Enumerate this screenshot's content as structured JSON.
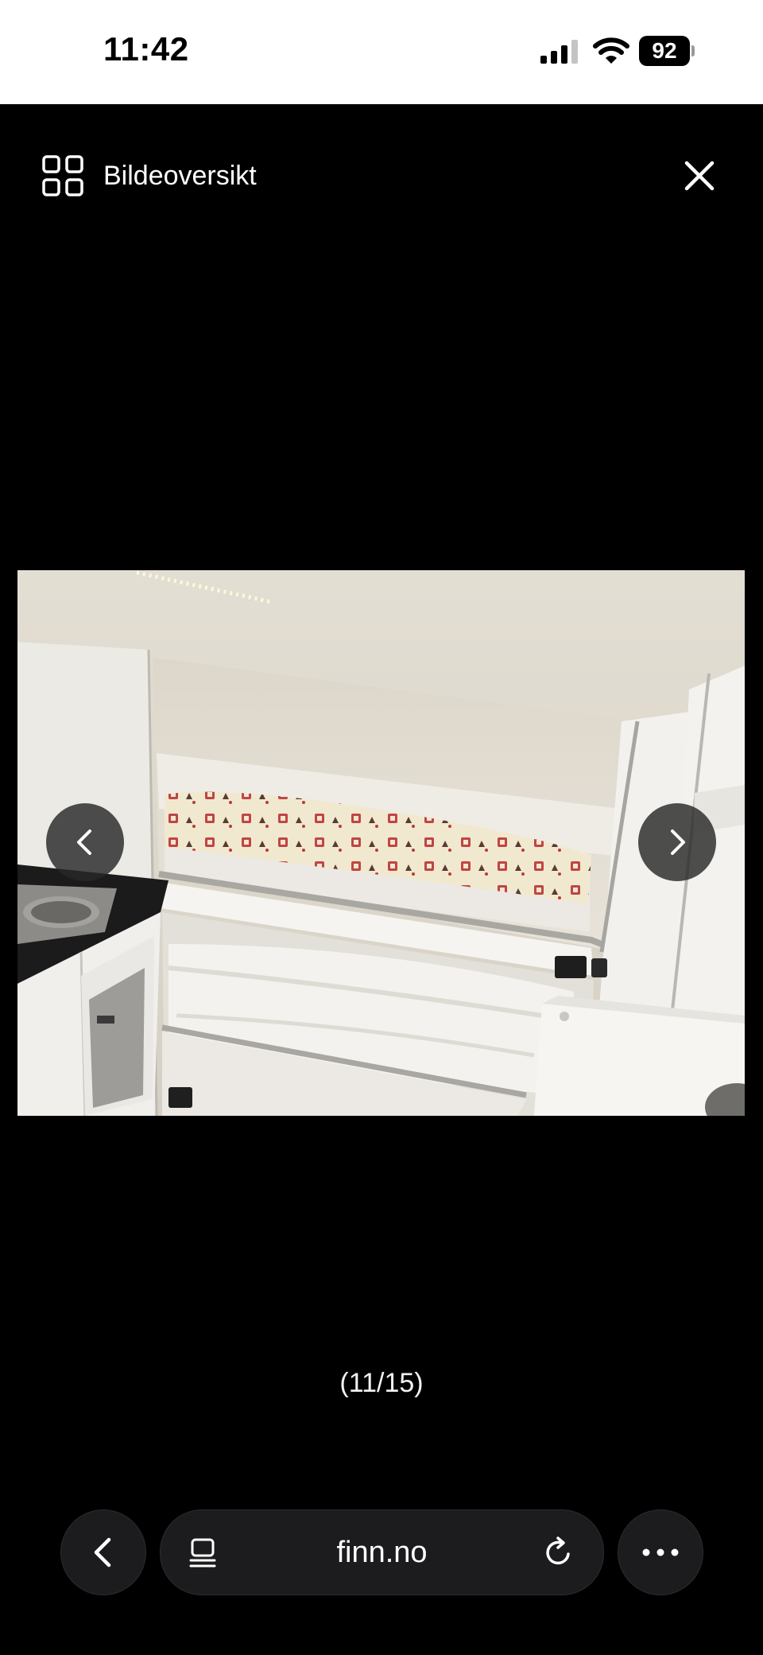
{
  "status_bar": {
    "time": "11:42",
    "battery": "92",
    "icons": [
      "cellular-signal-icon",
      "wifi-icon",
      "battery-icon"
    ]
  },
  "viewer": {
    "overview_label": "Bildeoversikt",
    "overview_icon": "grid-icon",
    "close_icon": "close-icon",
    "prev_icon": "chevron-left-icon",
    "next_icon": "chevron-right-icon",
    "counter": "(11/15)",
    "photo": {
      "subject": "camper interior with bunk beds and kitchenette",
      "accent_colors": [
        "#e9e4da",
        "#f2ead2",
        "#b73a3a",
        "#1d1d1d"
      ]
    }
  },
  "browser": {
    "url": "finn.no",
    "back_icon": "chevron-left-icon",
    "reader_icon": "page-menu-icon",
    "reload_icon": "reload-icon",
    "more_icon": "more-icon"
  },
  "colors": {
    "background": "#000000",
    "status_bar": "#ffffff",
    "control_fill": "#1c1c1e"
  }
}
